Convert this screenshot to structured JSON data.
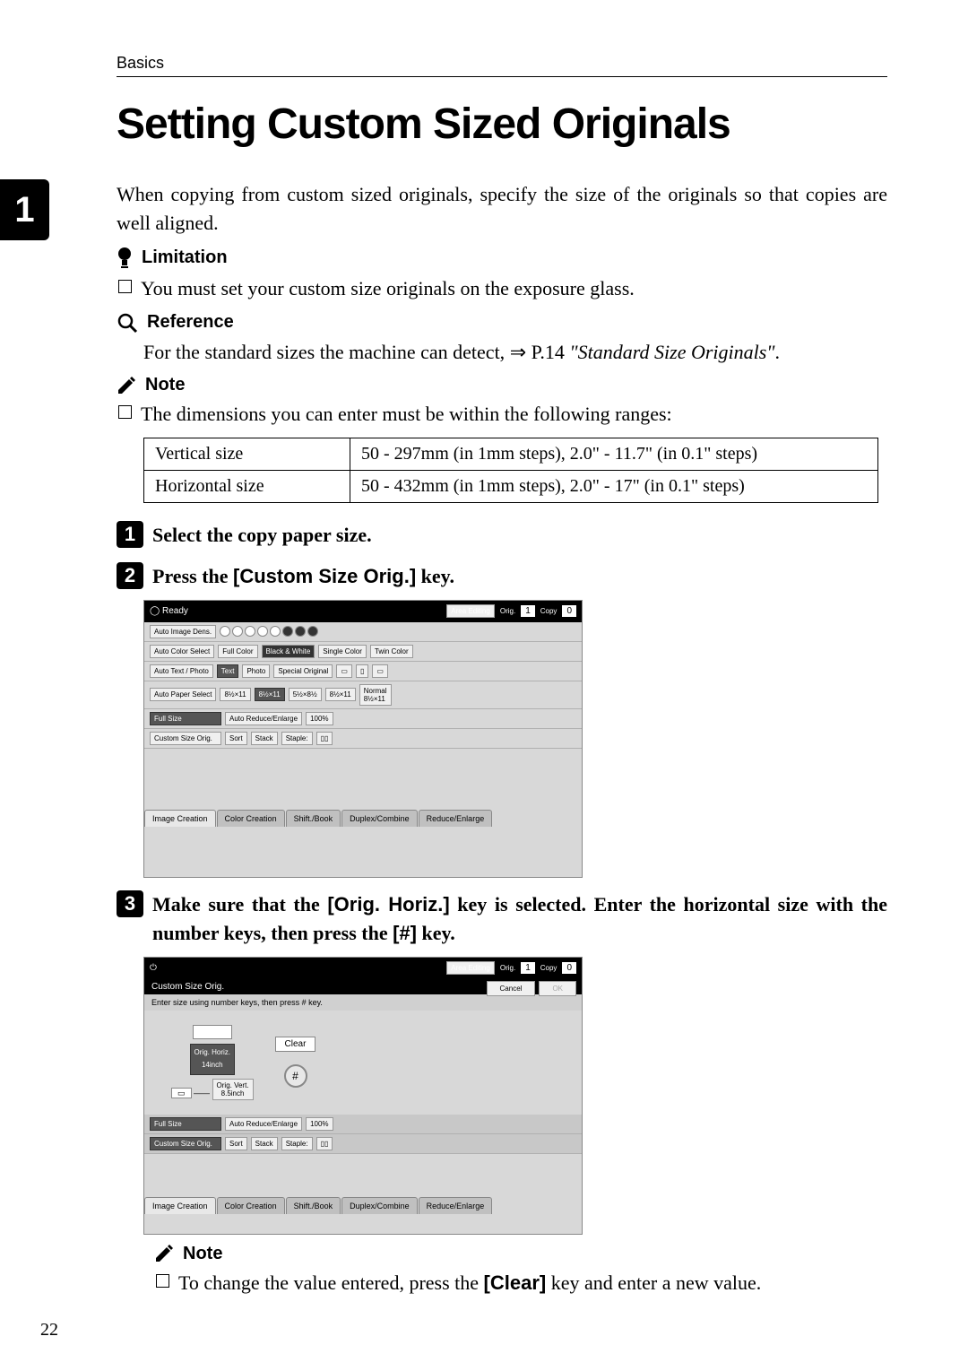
{
  "header": {
    "section": "Basics"
  },
  "tab": {
    "number": "1"
  },
  "title": "Setting Custom Sized Originals",
  "intro": "When copying from custom sized originals, specify the size of the originals so that copies are well aligned.",
  "limitation": {
    "heading": "Limitation",
    "item": "You must set your custom size originals on the exposure glass."
  },
  "reference": {
    "heading": "Reference",
    "prefix": "For the standard sizes the machine can detect, ",
    "arrow": "⇒",
    "pageref": " P.14 ",
    "italic": "\"Standard Size Originals\"",
    "suffix": "."
  },
  "note1": {
    "heading": "Note",
    "item": "The dimensions you can enter must be within the following ranges:"
  },
  "table": {
    "rows": [
      {
        "label": "Vertical size",
        "value": "50 - 297mm (in 1mm steps), 2.0\" - 11.7\" (in 0.1\" steps)"
      },
      {
        "label": "Horizontal size",
        "value": "50 - 432mm (in 1mm steps), 2.0\" - 17\" (in 0.1\" steps)"
      }
    ]
  },
  "steps": {
    "s1": {
      "num": "1",
      "text": "Select the copy paper size."
    },
    "s2": {
      "num": "2",
      "prefix": "Press the ",
      "key": "[Custom Size Orig.]",
      "suffix": " key."
    },
    "s3": {
      "num": "3",
      "p1": "Make sure that the ",
      "key1": "[Orig. Horiz.]",
      "p2": " key is selected. Enter the horizontal size with the number keys, then press the ",
      "key2": "[#]",
      "p3": " key."
    }
  },
  "screen1": {
    "ready": "Ready",
    "area_editing": "Area Editing",
    "orig_label": "Orig.",
    "copy_label": "Copy",
    "orig_count": "1",
    "copy_count": "0",
    "row_autoimage": "Auto Image Dens.",
    "row_color": {
      "label": "Auto Color Select",
      "b1": "Full Color",
      "b2": "Black & White",
      "b3": "Single Color",
      "b4": "Twin Color"
    },
    "row_text": {
      "label": "Auto Text / Photo",
      "b1": "Text",
      "b2": "Photo",
      "b3": "Special Original"
    },
    "row_paper": {
      "label": "Auto Paper Select",
      "p1": "8½×11",
      "p2": "8½×11",
      "p3": "5½×8½",
      "p4": "8½×11",
      "p5": "8½×11",
      "normal": "Normal"
    },
    "row_size": {
      "b1": "Full Size",
      "b2": "Auto Reduce/Enlarge",
      "b3": "100%"
    },
    "row_custom": {
      "b1": "Custom Size Orig.",
      "b2": "Sort",
      "b3": "Stack",
      "b4": "Staple:"
    },
    "tabs": [
      "Image Creation",
      "Color Creation",
      "Shift./Book",
      "Duplex/Combine",
      "Reduce/Enlarge"
    ]
  },
  "screen2": {
    "area_editing": "Area Editing",
    "orig_label": "Orig.",
    "copy_label": "Copy",
    "orig_count": "1",
    "copy_count": "0",
    "header": "Custom Size Orig.",
    "cancel": "Cancel",
    "ok": "OK",
    "instruction": "Enter size using number keys, then press # key.",
    "horiz_label": "Orig. Horiz.",
    "horiz_sub": "14inch",
    "vert_label": "Orig. Vert.",
    "vert_sub": "8.5inch",
    "clear": "Clear",
    "hash": "#",
    "row_size": {
      "b1": "Full Size",
      "b2": "Auto Reduce/Enlarge",
      "b3": "100%"
    },
    "row_custom": {
      "b1": "Custom Size Orig.",
      "b2": "Sort",
      "b3": "Stack",
      "b4": "Staple:"
    },
    "tabs": [
      "Image Creation",
      "Color Creation",
      "Shift./Book",
      "Duplex/Combine",
      "Reduce/Enlarge"
    ]
  },
  "note2": {
    "heading": "Note",
    "prefix": "To change the value entered, press the ",
    "key": "[Clear]",
    "suffix": " key and enter a new value."
  },
  "page_number": "22"
}
